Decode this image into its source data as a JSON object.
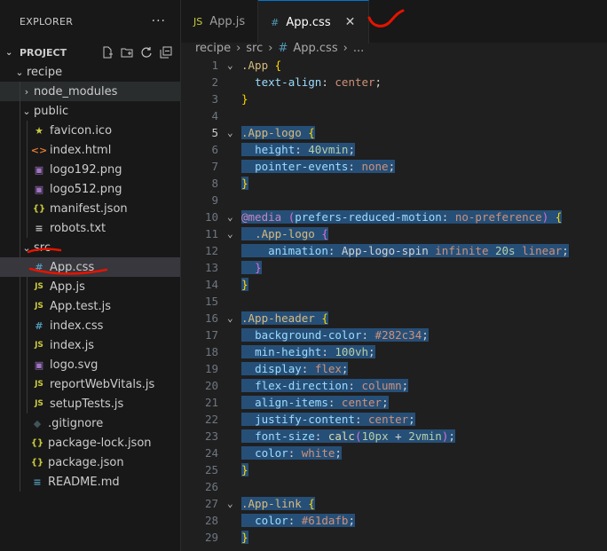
{
  "explorer": {
    "title": "EXPLORER",
    "more": "···",
    "project": "PROJECT"
  },
  "tree": [
    {
      "label": "recipe",
      "type": "folder",
      "open": true,
      "depth": 1
    },
    {
      "label": "node_modules",
      "type": "folder",
      "open": false,
      "depth": 2
    },
    {
      "label": "public",
      "type": "folder",
      "open": true,
      "depth": 2
    },
    {
      "label": "favicon.ico",
      "type": "star",
      "depth": 3
    },
    {
      "label": "index.html",
      "type": "html",
      "depth": 3
    },
    {
      "label": "logo192.png",
      "type": "img",
      "depth": 3
    },
    {
      "label": "logo512.png",
      "type": "img",
      "depth": 3
    },
    {
      "label": "manifest.json",
      "type": "json",
      "depth": 3
    },
    {
      "label": "robots.txt",
      "type": "txt",
      "depth": 3
    },
    {
      "label": "src",
      "type": "folder",
      "open": true,
      "depth": 2
    },
    {
      "label": "App.css",
      "type": "css",
      "depth": 3
    },
    {
      "label": "App.js",
      "type": "js",
      "depth": 3
    },
    {
      "label": "App.test.js",
      "type": "js",
      "depth": 3
    },
    {
      "label": "index.css",
      "type": "css",
      "depth": 3
    },
    {
      "label": "index.js",
      "type": "js",
      "depth": 3
    },
    {
      "label": "logo.svg",
      "type": "img",
      "depth": 3
    },
    {
      "label": "reportWebVitals.js",
      "type": "js",
      "depth": 3
    },
    {
      "label": "setupTests.js",
      "type": "js",
      "depth": 3
    },
    {
      "label": ".gitignore",
      "type": "git",
      "depth": 2
    },
    {
      "label": "package-lock.json",
      "type": "json",
      "depth": 2
    },
    {
      "label": "package.json",
      "type": "json",
      "depth": 2
    },
    {
      "label": "README.md",
      "type": "md",
      "depth": 2
    }
  ],
  "tabs": [
    {
      "label": "App.js",
      "icon": "JS",
      "active": false
    },
    {
      "label": "App.css",
      "icon": "#",
      "active": true,
      "close": "✕"
    }
  ],
  "breadcrumbs": [
    "recipe",
    "src",
    "App.css",
    "..."
  ],
  "code_lines": [
    {
      "n": "1",
      "hl": false,
      "t": [
        [
          ".App ",
          "sel-k"
        ],
        [
          "{",
          "brace"
        ]
      ]
    },
    {
      "n": "2",
      "hl": false,
      "t": [
        [
          "  ",
          "plain"
        ],
        [
          "text-align",
          "prop"
        ],
        [
          ": ",
          "plain"
        ],
        [
          "center",
          "val"
        ],
        [
          ";",
          "plain"
        ]
      ]
    },
    {
      "n": "3",
      "hl": false,
      "t": [
        [
          "}",
          "brace"
        ]
      ]
    },
    {
      "n": "4",
      "hl": false,
      "t": []
    },
    {
      "n": "5",
      "hl": true,
      "t": [
        [
          ".App-logo ",
          "sel-k"
        ],
        [
          "{",
          "brace"
        ]
      ]
    },
    {
      "n": "6",
      "hl": true,
      "t": [
        [
          "  ",
          "plain"
        ],
        [
          "height",
          "prop"
        ],
        [
          ": ",
          "plain"
        ],
        [
          "40vmin",
          "num"
        ],
        [
          ";",
          "plain"
        ]
      ]
    },
    {
      "n": "7",
      "hl": true,
      "t": [
        [
          "  ",
          "plain"
        ],
        [
          "pointer-events",
          "prop"
        ],
        [
          ": ",
          "plain"
        ],
        [
          "none",
          "val"
        ],
        [
          ";",
          "plain"
        ]
      ]
    },
    {
      "n": "8",
      "hl": true,
      "t": [
        [
          "}",
          "brace"
        ]
      ]
    },
    {
      "n": "9",
      "hl": false,
      "t": []
    },
    {
      "n": "10",
      "hl": true,
      "t": [
        [
          "@media ",
          "kw"
        ],
        [
          "(",
          "br2"
        ],
        [
          "prefers-reduced-motion",
          "prop"
        ],
        [
          ": ",
          "plain"
        ],
        [
          "no-preference",
          "val"
        ],
        [
          ") ",
          "br2"
        ],
        [
          "{",
          "brace"
        ]
      ]
    },
    {
      "n": "11",
      "hl": true,
      "t": [
        [
          "  ",
          "plain"
        ],
        [
          ".App-logo ",
          "sel-k"
        ],
        [
          "{",
          "br2"
        ]
      ]
    },
    {
      "n": "12",
      "hl": true,
      "t": [
        [
          "    ",
          "plain"
        ],
        [
          "animation",
          "prop"
        ],
        [
          ": ",
          "plain"
        ],
        [
          "App-logo-spin ",
          "plain"
        ],
        [
          "infinite ",
          "val"
        ],
        [
          "20s ",
          "num"
        ],
        [
          "linear",
          "val"
        ],
        [
          ";",
          "plain"
        ]
      ]
    },
    {
      "n": "13",
      "hl": true,
      "t": [
        [
          "  ",
          "plain"
        ],
        [
          "}",
          "br2"
        ]
      ]
    },
    {
      "n": "14",
      "hl": true,
      "t": [
        [
          "}",
          "brace"
        ]
      ]
    },
    {
      "n": "15",
      "hl": false,
      "t": []
    },
    {
      "n": "16",
      "hl": true,
      "t": [
        [
          ".App-header ",
          "sel-k"
        ],
        [
          "{",
          "brace"
        ]
      ]
    },
    {
      "n": "17",
      "hl": true,
      "t": [
        [
          "  ",
          "plain"
        ],
        [
          "background-color",
          "prop"
        ],
        [
          ": ",
          "plain"
        ],
        [
          "#282c34",
          "val"
        ],
        [
          ";",
          "plain"
        ]
      ]
    },
    {
      "n": "18",
      "hl": true,
      "t": [
        [
          "  ",
          "plain"
        ],
        [
          "min-height",
          "prop"
        ],
        [
          ": ",
          "plain"
        ],
        [
          "100vh",
          "num"
        ],
        [
          ";",
          "plain"
        ]
      ]
    },
    {
      "n": "19",
      "hl": true,
      "t": [
        [
          "  ",
          "plain"
        ],
        [
          "display",
          "prop"
        ],
        [
          ": ",
          "plain"
        ],
        [
          "flex",
          "val"
        ],
        [
          ";",
          "plain"
        ]
      ]
    },
    {
      "n": "20",
      "hl": true,
      "t": [
        [
          "  ",
          "plain"
        ],
        [
          "flex-direction",
          "prop"
        ],
        [
          ": ",
          "plain"
        ],
        [
          "column",
          "val"
        ],
        [
          ";",
          "plain"
        ]
      ]
    },
    {
      "n": "21",
      "hl": true,
      "t": [
        [
          "  ",
          "plain"
        ],
        [
          "align-items",
          "prop"
        ],
        [
          ": ",
          "plain"
        ],
        [
          "center",
          "val"
        ],
        [
          ";",
          "plain"
        ]
      ]
    },
    {
      "n": "22",
      "hl": true,
      "t": [
        [
          "  ",
          "plain"
        ],
        [
          "justify-content",
          "prop"
        ],
        [
          ": ",
          "plain"
        ],
        [
          "center",
          "val"
        ],
        [
          ";",
          "plain"
        ]
      ]
    },
    {
      "n": "23",
      "hl": true,
      "t": [
        [
          "  ",
          "plain"
        ],
        [
          "font-size",
          "prop"
        ],
        [
          ": ",
          "plain"
        ],
        [
          "calc",
          "fn"
        ],
        [
          "(",
          "br2"
        ],
        [
          "10px",
          "num"
        ],
        [
          " + ",
          "plain"
        ],
        [
          "2vmin",
          "num"
        ],
        [
          ")",
          "br2"
        ],
        [
          ";",
          "plain"
        ]
      ]
    },
    {
      "n": "24",
      "hl": true,
      "t": [
        [
          "  ",
          "plain"
        ],
        [
          "color",
          "prop"
        ],
        [
          ": ",
          "plain"
        ],
        [
          "white",
          "val"
        ],
        [
          ";",
          "plain"
        ]
      ]
    },
    {
      "n": "25",
      "hl": true,
      "t": [
        [
          "}",
          "brace"
        ]
      ]
    },
    {
      "n": "26",
      "hl": false,
      "t": []
    },
    {
      "n": "27",
      "hl": true,
      "t": [
        [
          ".App-link ",
          "sel-k"
        ],
        [
          "{",
          "brace"
        ]
      ]
    },
    {
      "n": "28",
      "hl": true,
      "t": [
        [
          "  ",
          "plain"
        ],
        [
          "color",
          "prop"
        ],
        [
          ": ",
          "plain"
        ],
        [
          "#61dafb",
          "val"
        ],
        [
          ";",
          "plain"
        ]
      ]
    },
    {
      "n": "29",
      "hl": true,
      "t": [
        [
          "}",
          "brace"
        ]
      ]
    }
  ],
  "colors": {
    "accent": "#0078d4",
    "selection": "#264f78",
    "annotation": "#e51400"
  }
}
